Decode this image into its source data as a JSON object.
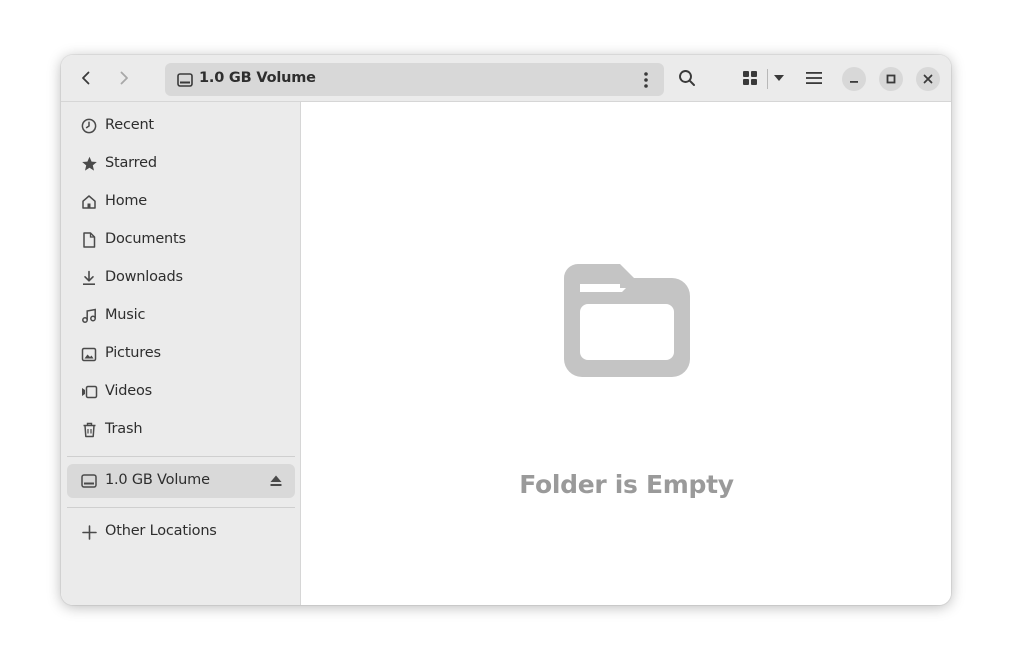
{
  "header": {
    "path_label": "1.0 GB Volume",
    "icons": {
      "back": "chevron-left-icon",
      "forward": "chevron-right-icon",
      "search": "search-icon",
      "view": "grid-view-icon",
      "view_options": "chevron-down-icon",
      "menu": "hamburger-menu-icon",
      "minimize": "minimize-icon",
      "maximize": "maximize-icon",
      "close": "close-icon"
    }
  },
  "sidebar": {
    "items": [
      {
        "label": "Recent",
        "icon": "clock-icon"
      },
      {
        "label": "Starred",
        "icon": "star-icon"
      },
      {
        "label": "Home",
        "icon": "home-icon"
      },
      {
        "label": "Documents",
        "icon": "document-icon"
      },
      {
        "label": "Downloads",
        "icon": "download-icon"
      },
      {
        "label": "Music",
        "icon": "music-icon"
      },
      {
        "label": "Pictures",
        "icon": "picture-icon"
      },
      {
        "label": "Videos",
        "icon": "video-icon"
      },
      {
        "label": "Trash",
        "icon": "trash-icon"
      }
    ],
    "volume": {
      "label": "1.0 GB Volume",
      "icon": "drive-icon",
      "selected": true
    },
    "other_locations": {
      "label": "Other Locations",
      "icon": "plus-icon"
    }
  },
  "content": {
    "empty_message": "Folder is Empty",
    "empty_icon": "folder-icon"
  },
  "colors": {
    "headerbar": "#ebebeb",
    "sidebar": "#ebebeb",
    "pathbar": "#d8d8d8",
    "selected": "#d9d9d9",
    "empty_text": "#9a9a9a",
    "empty_icon": "#c4c4c4"
  }
}
